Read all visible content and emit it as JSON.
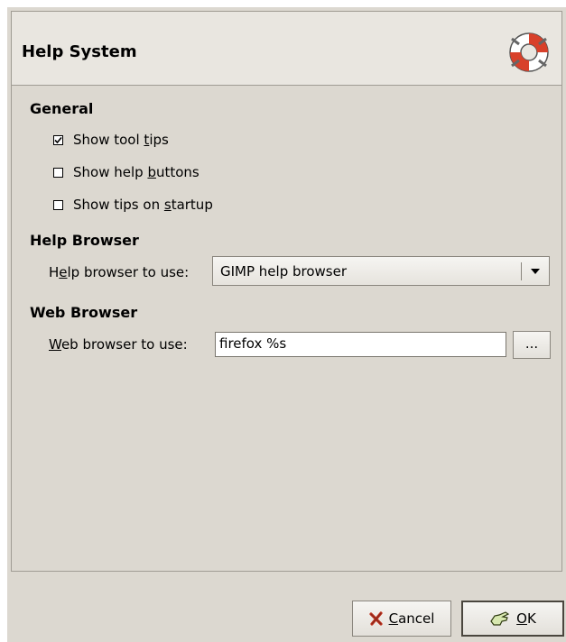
{
  "header": {
    "title": "Help System",
    "icon": "help-lifebuoy-icon"
  },
  "general": {
    "heading": "General",
    "options": [
      {
        "pre": "Show tool ",
        "mnemonic": "t",
        "post": "ips",
        "checked": true
      },
      {
        "pre": "Show help ",
        "mnemonic": "b",
        "post": "uttons",
        "checked": false
      },
      {
        "pre": "Show tips on ",
        "mnemonic": "s",
        "post": "tartup",
        "checked": false
      }
    ]
  },
  "help_browser": {
    "heading": "Help Browser",
    "label_pre": "H",
    "label_mnemonic": "e",
    "label_post": "lp browser to use:",
    "selected": "GIMP help browser"
  },
  "web_browser": {
    "heading": "Web Browser",
    "label_mnemonic": "W",
    "label_post": "eb browser to use:",
    "value": "firefox %s",
    "browse_label": "..."
  },
  "buttons": {
    "cancel_mnemonic": "C",
    "cancel_rest": "ancel",
    "ok_mnemonic": "O",
    "ok_rest": "K"
  }
}
